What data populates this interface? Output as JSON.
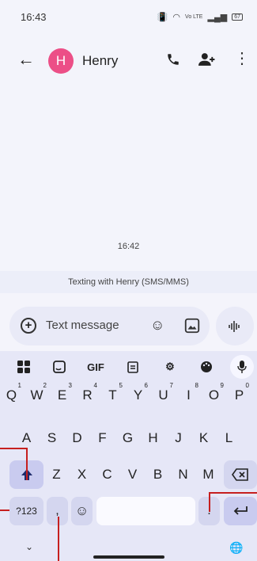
{
  "status_bar": {
    "time": "16:43",
    "network": "Vo LTE",
    "battery": "67"
  },
  "conversation": {
    "contact_initial": "H",
    "contact_name": "Henry"
  },
  "messages": {
    "timestamp": "16:42",
    "texting_with": "Texting with Henry (SMS/MMS)"
  },
  "composer": {
    "placeholder": "Text message"
  },
  "keyboard": {
    "toolbar": {
      "gif_label": "GIF"
    },
    "row1": [
      {
        "key": "Q",
        "hint": "1"
      },
      {
        "key": "W",
        "hint": "2"
      },
      {
        "key": "E",
        "hint": "3"
      },
      {
        "key": "R",
        "hint": "4"
      },
      {
        "key": "T",
        "hint": "5"
      },
      {
        "key": "Y",
        "hint": "6"
      },
      {
        "key": "U",
        "hint": "7"
      },
      {
        "key": "I",
        "hint": "8"
      },
      {
        "key": "O",
        "hint": "9"
      },
      {
        "key": "P",
        "hint": "0"
      }
    ],
    "row2": [
      "A",
      "S",
      "D",
      "F",
      "G",
      "H",
      "J",
      "K",
      "L"
    ],
    "row3": [
      "Z",
      "X",
      "C",
      "V",
      "B",
      "N",
      "M"
    ],
    "symbols_label": "?123",
    "comma": ",",
    "period": "."
  },
  "colors": {
    "avatar": "#ec4f87",
    "keyboard_bg": "#e6e7f7",
    "callout": "#c61f1f"
  }
}
